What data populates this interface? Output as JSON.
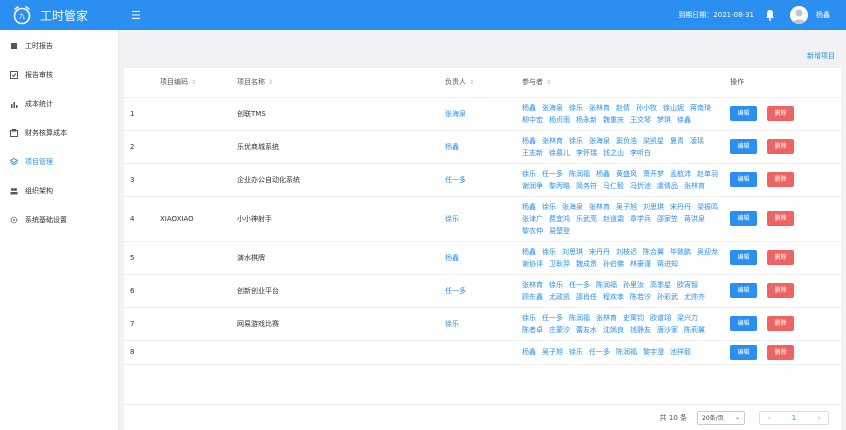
{
  "app": {
    "title": "工时管家"
  },
  "header": {
    "expire": "到期日期：2021-08-31",
    "user": "杨鑫"
  },
  "sidebar": {
    "items": [
      {
        "label": "工时报告",
        "icon": "report-icon"
      },
      {
        "label": "报告审核",
        "icon": "check-icon"
      },
      {
        "label": "成本统计",
        "icon": "chart-icon"
      },
      {
        "label": "财务核算成本",
        "icon": "finance-icon"
      },
      {
        "label": "项目管理",
        "icon": "layers-icon"
      },
      {
        "label": "组织架构",
        "icon": "org-icon"
      },
      {
        "label": "系统基础设置",
        "icon": "gear-icon"
      }
    ]
  },
  "toolbar": {
    "add": "新增项目"
  },
  "table": {
    "headers": {
      "code": "项目编码",
      "name": "项目名称",
      "owner": "负责人",
      "participants": "参与者",
      "ops": "操作"
    },
    "edit_label": "编辑",
    "delete_label": "删除",
    "rows": [
      {
        "index": "1",
        "code": "",
        "name": "创联TMS",
        "owner": "张海泉",
        "participants": [
          "杨鑫",
          "张海泉",
          "徐乐",
          "张林育",
          "赵倩",
          "孙小牧",
          "徐山妮",
          "蒋南琦",
          "柳中宏",
          "杨贞雨",
          "杨永新",
          "魏重庆",
          "王文琴",
          "梦琪",
          "徐鑫"
        ]
      },
      {
        "index": "2",
        "code": "",
        "name": "乐优商城系统",
        "owner": "杨鑫",
        "participants": [
          "杨鑫",
          "张林育",
          "徐乐",
          "张海泉",
          "窦负浩",
          "梁凯星",
          "夏青",
          "凌瑶",
          "王志新",
          "徐慕儿",
          "李怀瑞",
          "钱之山",
          "李听白"
        ]
      },
      {
        "index": "3",
        "code": "",
        "name": "企业办公自动化系统",
        "owner": "任一多",
        "participants": [
          "徐乐",
          "任一多",
          "陈润福",
          "杨鑫",
          "黄盛风",
          "萧开梦",
          "孟航沛",
          "赵单羽",
          "谢润争",
          "黎丙略",
          "简务符",
          "马仁毅",
          "冯忻池",
          "虞倩品",
          "张林育"
        ]
      },
      {
        "index": "4",
        "code": "XIAOXIAO",
        "name": "小小神射手",
        "owner": "徐乐",
        "participants": [
          "杨鑫",
          "徐乐",
          "张海泉",
          "张林育",
          "吴子旭",
          "刘思琪",
          "宋丹丹",
          "梁振鸣",
          "张津广",
          "费宜鸿",
          "乐武亮",
          "赵道霜",
          "章学兵",
          "邵家笠",
          "蒋洪泉",
          "黎衣仲",
          "易楚登"
        ]
      },
      {
        "index": "5",
        "code": "",
        "name": "演水棋牌",
        "owner": "杨鑫",
        "participants": [
          "杨鑫",
          "徐乐",
          "刘思琪",
          "宋丹丹",
          "刘枝迟",
          "陈合翼",
          "毕致鹏",
          "吴迎龙",
          "谢协评",
          "卫耿羿",
          "魏成贵",
          "孙伯佛",
          "林豪谨",
          "蒋进知"
        ]
      },
      {
        "index": "6",
        "code": "",
        "name": "创新创业平台",
        "owner": "任一多",
        "participants": [
          "张林育",
          "徐乐",
          "任一多",
          "陈润福",
          "孙里汝",
          "高季星",
          "欧宵智",
          "顾东鑫",
          "尤政凯",
          "邵肖任",
          "程欢孝",
          "陈若汐",
          "孙彩武",
          "尤帅齐"
        ]
      },
      {
        "index": "7",
        "code": "",
        "name": "网易游戏比赛",
        "owner": "徐乐",
        "participants": [
          "徐乐",
          "任一多",
          "陈润福",
          "张林育",
          "史寓钧",
          "欧谱翊",
          "梁兴力",
          "陈者卓",
          "庄蒙汐",
          "蕾友水",
          "沈嫣良",
          "钱静友",
          "唐沙家",
          "陈莉翼"
        ]
      },
      {
        "index": "8",
        "code": "",
        "name": "",
        "owner": "",
        "participants": [
          "杨鑫",
          "吴子旭",
          "徐乐",
          "任一多",
          "陈润福",
          "黎宇澄",
          "池祥毅"
        ]
      }
    ]
  },
  "footer": {
    "total": "共 10 条",
    "pagesize": "20条/页",
    "page": "1"
  },
  "colors": {
    "primary": "#2a8ff0",
    "danger": "#ee6464"
  }
}
